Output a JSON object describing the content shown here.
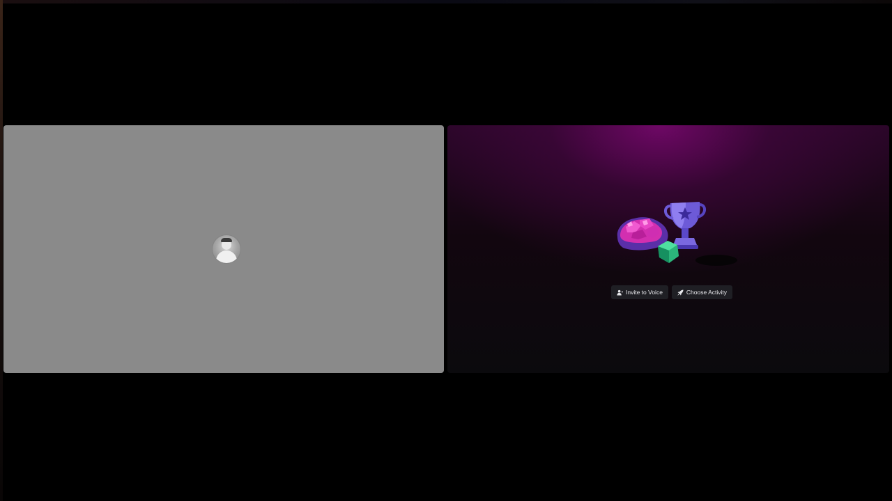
{
  "stage": {
    "background": "#000000"
  },
  "user_tile": {
    "background": "#8a8a8a",
    "avatar_icon": "user-avatar"
  },
  "activity_tile": {
    "illustration": "trophy-gems-dice-illustration",
    "accent": "#7a0870",
    "buttons": [
      {
        "label": "Invite to Voice",
        "icon": "person-add-icon"
      },
      {
        "label": "Choose Activity",
        "icon": "rocket-icon"
      }
    ]
  }
}
